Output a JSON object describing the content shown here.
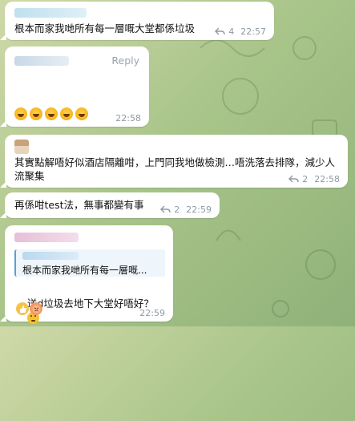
{
  "messages": [
    {
      "id": "m1",
      "text": "根本而家我哋所有每一層嘅大堂都係垃圾",
      "replies": "4",
      "time": "22:57"
    },
    {
      "id": "m2",
      "reply_label": "Reply",
      "time": "22:58"
    },
    {
      "id": "m3",
      "text": "其實點解唔好似酒店隔離咁，上門同我地做檢測…唔洗落去排隊，減少人流聚集",
      "replies": "2",
      "time": "22:58"
    },
    {
      "id": "m4",
      "text": "再係咁test法，無事都變有事",
      "replies": "2",
      "time": "22:59"
    },
    {
      "id": "m5",
      "quote": "根本而家我哋所有每一層嘅...",
      "text": "送d垃圾去地下大堂好唔好？",
      "time": "22:59"
    }
  ],
  "colors": {
    "background": "#a9c58a",
    "bubble": "#ffffff",
    "meta_text": "#8f9aa3",
    "quote_bar": "#5aa0d6"
  },
  "icons": {
    "reply": "reply-arrow-icon",
    "laugh": "laughing-face-emoji",
    "thinking": "thinking-face-emoji",
    "thumbs_up": "thumbs-up-emoji",
    "angry": "angry-face-emoji"
  }
}
